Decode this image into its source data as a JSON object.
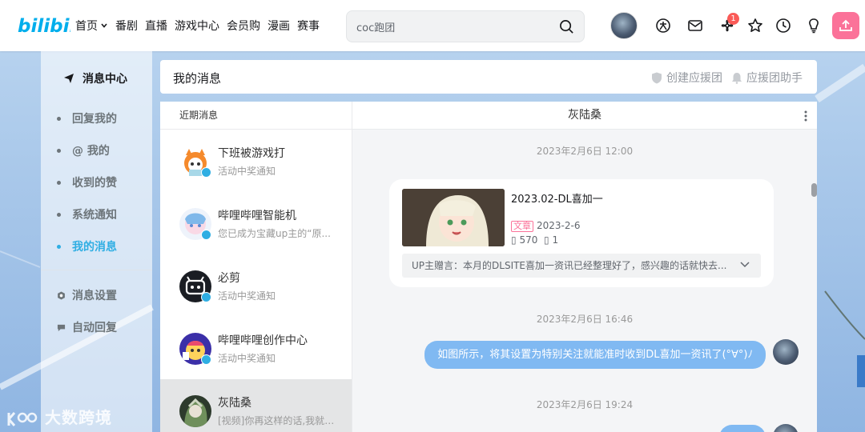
{
  "header": {
    "nav": [
      "首页",
      "番剧",
      "直播",
      "游戏中心",
      "会员购",
      "漫画",
      "赛事"
    ],
    "search_value": "coc跑团",
    "notification_count": "1",
    "icons": [
      "big-member-icon",
      "message-icon",
      "dynamic-icon",
      "favorite-icon",
      "history-icon",
      "creation-icon",
      "upload-icon"
    ],
    "accent": "#fb7299"
  },
  "sidebar": {
    "title": "消息中心",
    "items": [
      {
        "label": "回复我的"
      },
      {
        "label": "@ 我的"
      },
      {
        "label": "收到的赞"
      },
      {
        "label": "系统通知"
      },
      {
        "label": "我的消息",
        "active": true
      }
    ],
    "settings": [
      {
        "label": "消息设置"
      },
      {
        "label": "自动回复"
      }
    ],
    "active_color": "#2faee3"
  },
  "main": {
    "title": "我的消息",
    "actions": [
      "创建应援团",
      "应援团助手"
    ]
  },
  "conversations": {
    "header": "近期消息",
    "items": [
      {
        "name": "下班被游戏打",
        "preview": "活动中奖通知"
      },
      {
        "name": "哔哩哔哩智能机",
        "preview": "您已成为宝藏up主的“原..."
      },
      {
        "name": "必剪",
        "preview": "活动中奖通知"
      },
      {
        "name": "哔哩哔哩创作中心",
        "preview": "活动中奖通知"
      },
      {
        "name": "灰陆桑",
        "preview": "[视频]你再这样的话,我就要...",
        "selected": true
      }
    ]
  },
  "chat": {
    "title": "灰陆桑",
    "timestamps": [
      "2023年2月6日 12:00",
      "2023年2月6日 16:46",
      "2023年2月6日 19:24"
    ],
    "card": {
      "title": "2023.02-DL喜加一",
      "tag": "文章",
      "date": "2023-2-6",
      "views": "570",
      "likes": "1",
      "note": "UP主赠言：本月的DLSITE喜加一资讯已经整理好了，感兴趣的话就快去..."
    },
    "outgoing": "如图所示，将其设置为特别关注就能准时收到DL喜加一资讯了(°∀°)ﾉ"
  },
  "watermark": "大数跨境"
}
